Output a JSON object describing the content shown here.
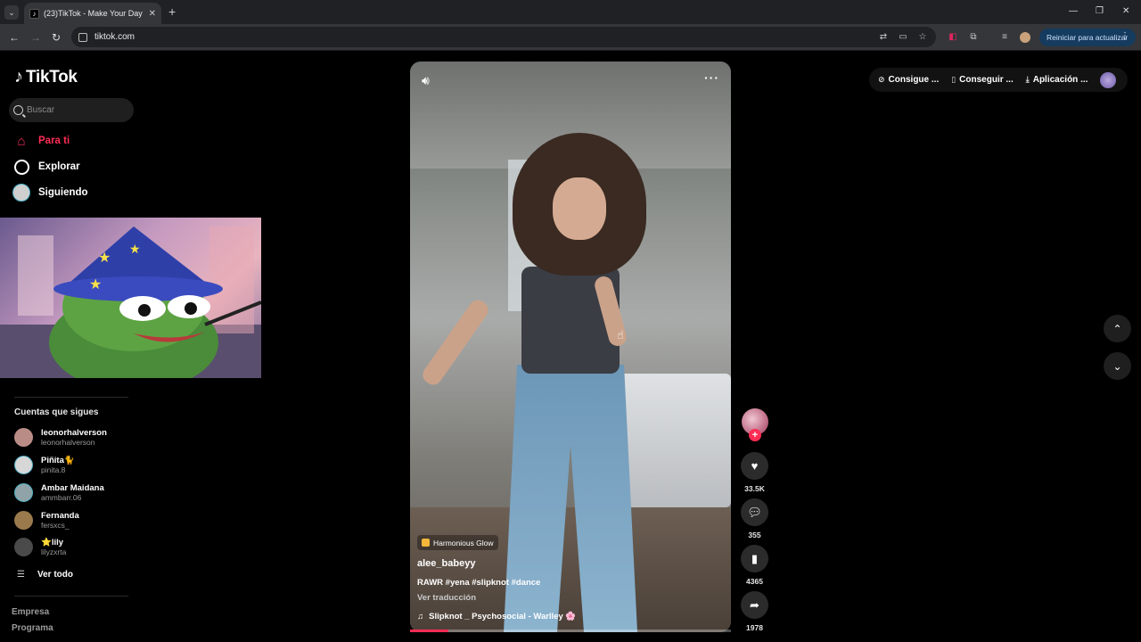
{
  "browser": {
    "tab_title": "(23)TikTok - Make Your Day",
    "url": "tiktok.com",
    "restart_label": "Reiniciar para actualizar"
  },
  "app": {
    "logo_text": "TikTok",
    "search_placeholder": "Buscar"
  },
  "sidebar": {
    "nav": [
      {
        "label": "Para ti"
      },
      {
        "label": "Explorar"
      },
      {
        "label": "Siguiendo"
      }
    ],
    "following_title": "Cuentas que sigues",
    "following": [
      {
        "name": "leonorhalverson",
        "handle": "leonorhalverson",
        "color": "#b98d86"
      },
      {
        "name": "Piñita🐈",
        "handle": "pinita.8",
        "color": "#d7d7d7"
      },
      {
        "name": "Ambar Maidana",
        "handle": "ammbarr.06",
        "color": "#8fa3a8"
      },
      {
        "name": "Fernanda",
        "handle": "fersxcs_",
        "color": "#9a7a4c"
      },
      {
        "name": "⭐lily",
        "handle": "lilyzxrta",
        "color": "#4a4a4a"
      }
    ],
    "see_all": "Ver todo",
    "footer": [
      "Empresa",
      "Programa"
    ]
  },
  "video": {
    "effect": "Harmonious Glow",
    "username": "alee_babeyy",
    "caption": "RAWR #yena #slipknot #dance",
    "translate": "Ver traducción",
    "music": "Slipknot _ Psychosocial - Warlley 🌸",
    "progress": 0.12
  },
  "actions": {
    "likes": "33.5K",
    "comments": "355",
    "saves": "4365",
    "shares": "1978"
  },
  "topbar": {
    "coins": "Consigue ...",
    "app_get": "Conseguir ...",
    "app": "Aplicación ..."
  },
  "colors": {
    "accent": "#fe2c55"
  }
}
